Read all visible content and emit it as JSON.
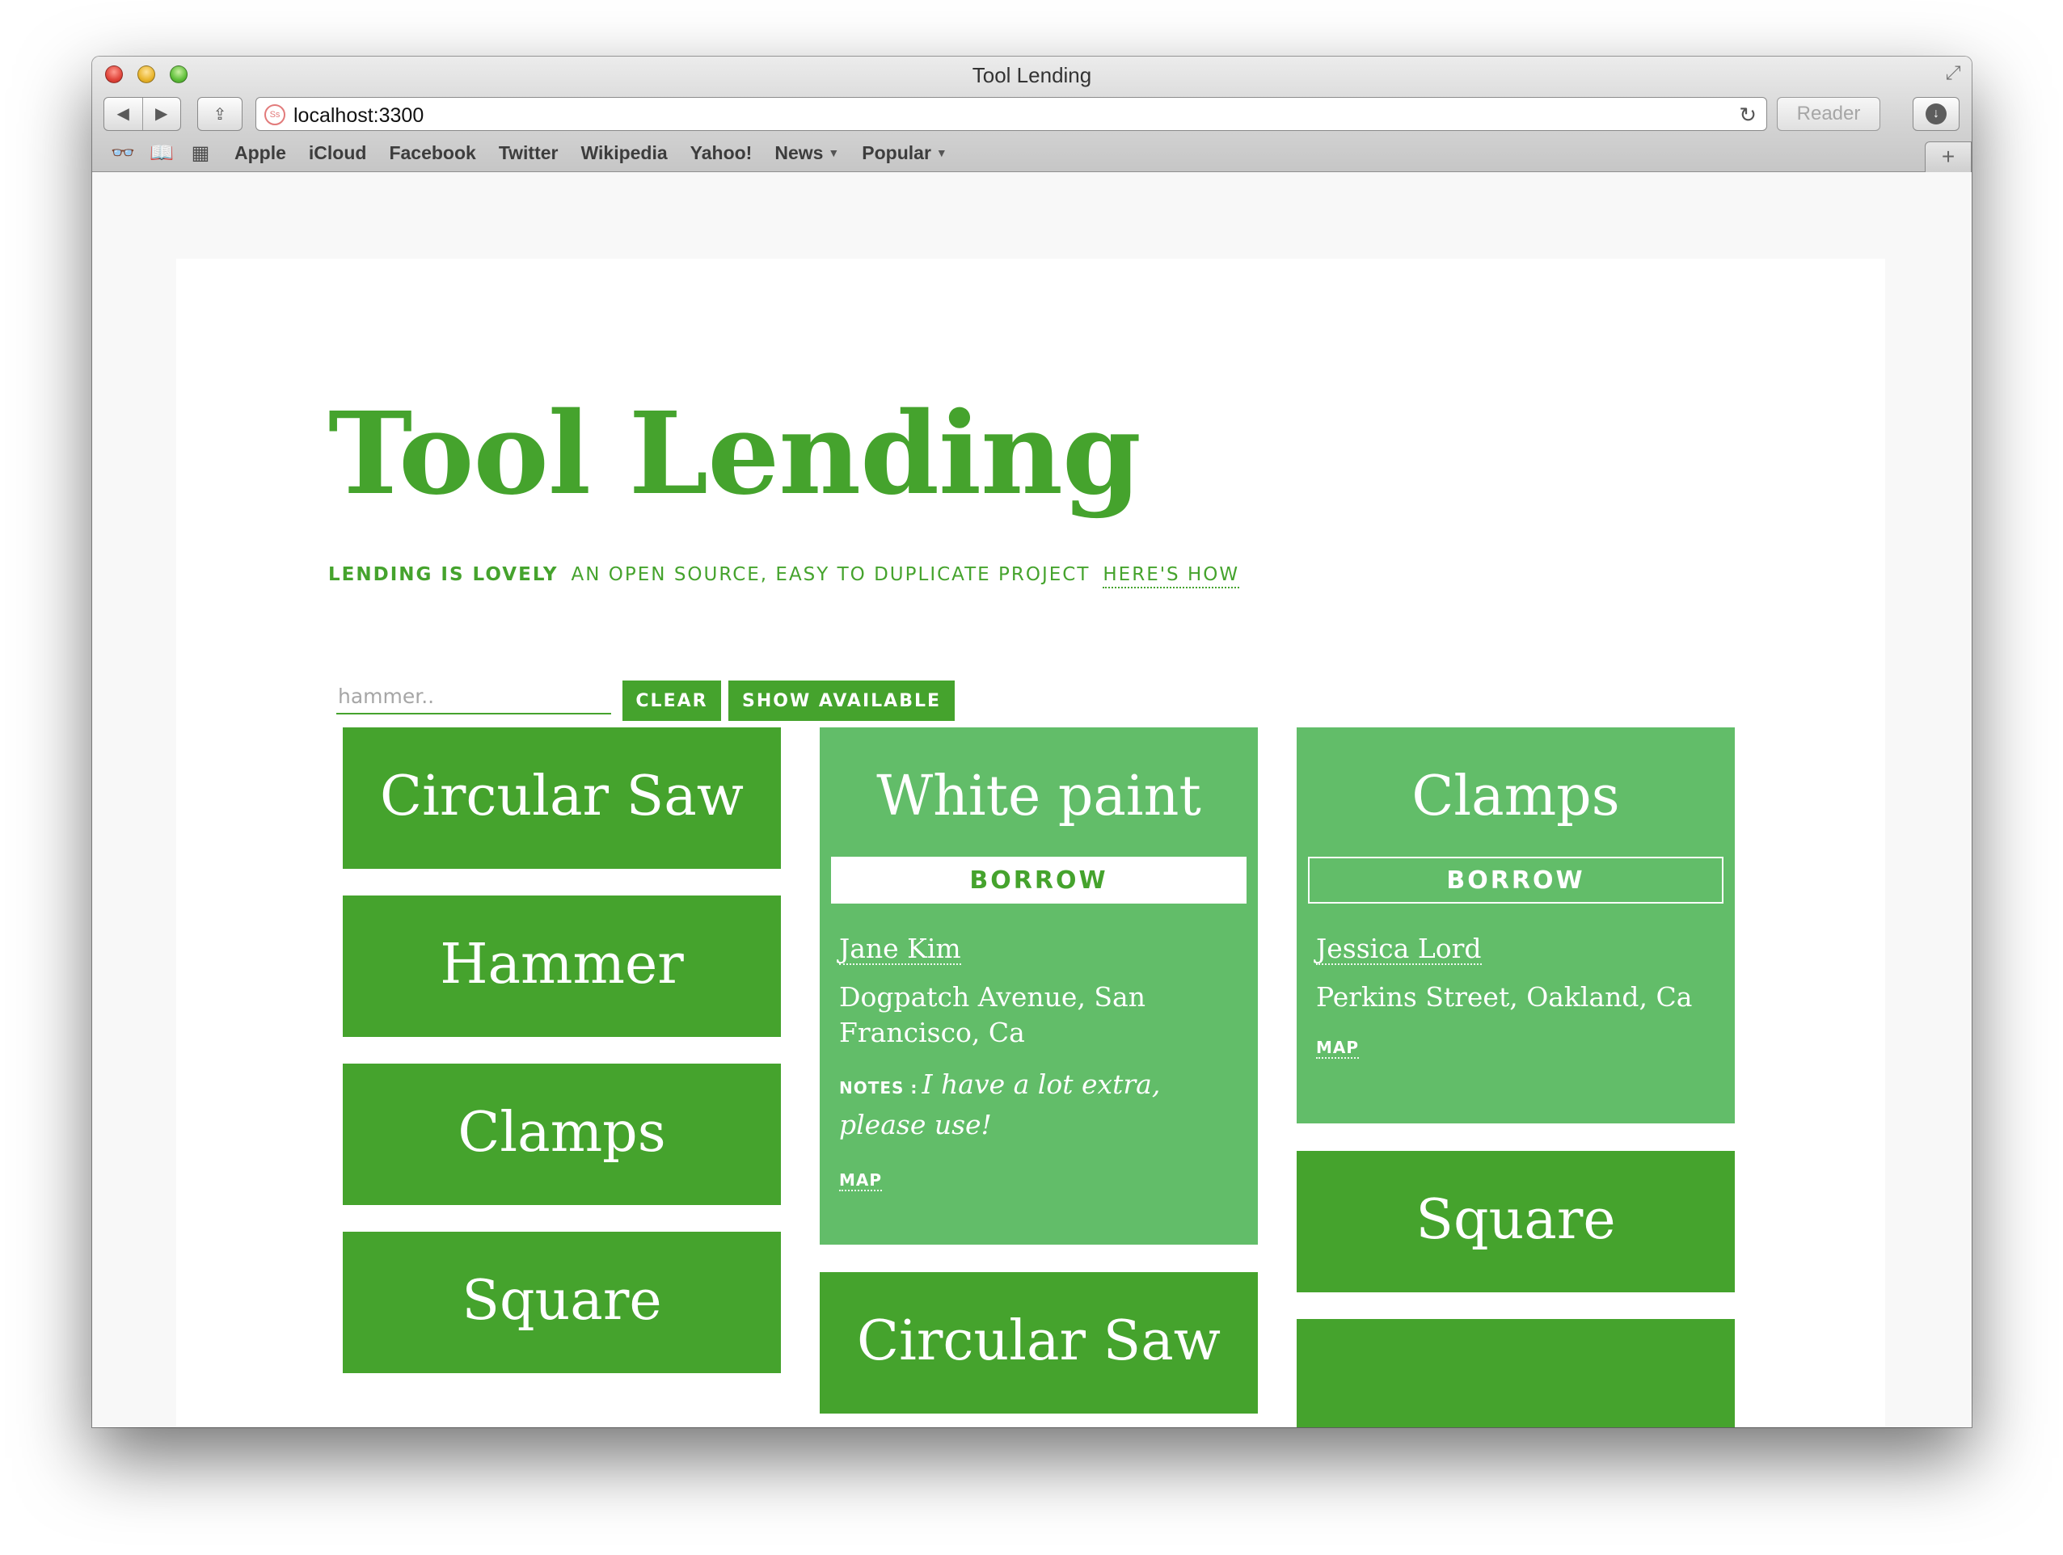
{
  "browser": {
    "window_title": "Tool Lending",
    "url": "localhost:3300",
    "site_icon": "Ss",
    "reader_label": "Reader",
    "icons": {
      "back": "back-arrow-icon",
      "forward": "forward-arrow-icon",
      "share": "share-icon",
      "reload": "reload-icon",
      "download": "download-icon",
      "reading_list": "reading-list-icon",
      "bookmarks": "bookmarks-book-icon",
      "top_sites": "top-sites-grid-icon",
      "fullscreen": "fullscreen-icon",
      "new_tab": "new-tab-plus-icon"
    },
    "bookmarks": [
      "Apple",
      "iCloud",
      "Facebook",
      "Twitter",
      "Wikipedia",
      "Yahoo!",
      "News",
      "Popular"
    ]
  },
  "site": {
    "title": "Tool Lending",
    "tagline_strong": "LENDING IS LOVELY",
    "tagline": "AN OPEN SOURCE, EASY TO DUPLICATE PROJECT",
    "tagline_link": "HERE'S HOW",
    "accent_color": "#45a32d",
    "light_card_color": "#62bd69"
  },
  "search": {
    "placeholder": "hammer..",
    "value": "",
    "clear_label": "CLEAR",
    "show_available_label": "SHOW AVAILABLE"
  },
  "cards": {
    "col1": [
      "Circular Saw",
      "Hammer",
      "Clamps",
      "Square"
    ],
    "white_paint": {
      "title": "White paint",
      "borrow_label": "BORROW",
      "lender": "Jane Kim",
      "address": "Dogpatch Avenue, San Francisco, Ca",
      "notes_label": "NOTES :",
      "notes": "I have a lot extra, please use!",
      "map_label": "MAP"
    },
    "col2_next": "Circular Saw",
    "clamps": {
      "title": "Clamps",
      "borrow_label": "BORROW",
      "lender": "Jessica Lord",
      "address": "Perkins Street, Oakland, Ca",
      "map_label": "MAP"
    },
    "col3_next": "Square"
  }
}
